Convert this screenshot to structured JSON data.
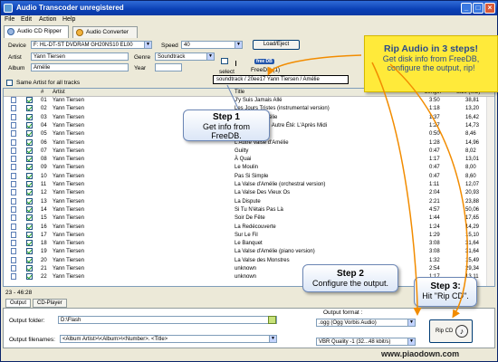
{
  "window": {
    "title": "Audio Transcoder unregistered"
  },
  "menu": [
    "File",
    "Edit",
    "Action",
    "Help"
  ],
  "tabs": [
    {
      "label": "Audio CD Ripper"
    },
    {
      "label": "Audio Converter"
    }
  ],
  "ripper": {
    "device_label": "Device",
    "device_value": "F: HL-DT-ST DVDRAM GH20NS10 EL00",
    "speed_label": "Speed",
    "speed_value": "40",
    "load_eject_label": "Load/Eject",
    "artist_label": "Artist",
    "artist_value": "Yann Tiersen",
    "genre_label": "Genre",
    "genre_value": "Soundtrack",
    "album_label": "Album",
    "album_value": "Amélie",
    "year_label": "Year",
    "year_value": "",
    "same_artist_label": "Same Artist for all tracks",
    "select_label": "select",
    "freedb_label": "FreeDB (1)",
    "freedb_logo": "free DB",
    "freedb_result": "soundtrack / 20ee17 Yann Tiersen / Amélie"
  },
  "grid": {
    "headers": {
      "check": "",
      "num": "#",
      "artist": "Artist",
      "title": "Title",
      "length": "Length",
      "size": "Size (MB)"
    },
    "rows": [
      {
        "num": "01",
        "artist": "Yann Tiersen",
        "title": "J'y Suis Jamais Allé",
        "length": "3:50",
        "size": "38,81"
      },
      {
        "num": "02",
        "artist": "Yann Tiersen",
        "title": "Les Jours Tristes (instrumental version)",
        "length": "1:18",
        "size": "13,20"
      },
      {
        "num": "03",
        "artist": "Yann Tiersen",
        "title": "La Valse d'Amélie",
        "length": "1:37",
        "size": "16,42"
      },
      {
        "num": "04",
        "artist": "Yann Tiersen",
        "title": "Comptine d'Un Autre Été: L'Après Midi",
        "length": "1:27",
        "size": "14,73"
      },
      {
        "num": "05",
        "artist": "Yann Tiersen",
        "title": "La Noyée",
        "length": "0:50",
        "size": "8,46"
      },
      {
        "num": "06",
        "artist": "Yann Tiersen",
        "title": "L'Autre Valse d'Amélie",
        "length": "1:28",
        "size": "14,96"
      },
      {
        "num": "07",
        "artist": "Yann Tiersen",
        "title": "Guilty",
        "length": "0:47",
        "size": "8,02"
      },
      {
        "num": "08",
        "artist": "Yann Tiersen",
        "title": "À Quai",
        "length": "1:17",
        "size": "13,01"
      },
      {
        "num": "09",
        "artist": "Yann Tiersen",
        "title": "Le Moulin",
        "length": "0:47",
        "size": "8,00"
      },
      {
        "num": "10",
        "artist": "Yann Tiersen",
        "title": "Pas Si Simple",
        "length": "0:47",
        "size": "8,60"
      },
      {
        "num": "11",
        "artist": "Yann Tiersen",
        "title": "La Valse d'Amélie (orchestral version)",
        "length": "1:11",
        "size": "12,07"
      },
      {
        "num": "12",
        "artist": "Yann Tiersen",
        "title": "La Valse Des Vieux Os",
        "length": "2:04",
        "size": "20,93"
      },
      {
        "num": "13",
        "artist": "Yann Tiersen",
        "title": "La Dispute",
        "length": "2:21",
        "size": "23,88"
      },
      {
        "num": "14",
        "artist": "Yann Tiersen",
        "title": "Si Tu N'étais Pas Là",
        "length": "4:57",
        "size": "50,06"
      },
      {
        "num": "15",
        "artist": "Yann Tiersen",
        "title": "Soir De Fête",
        "length": "1:44",
        "size": "17,65"
      },
      {
        "num": "16",
        "artist": "Yann Tiersen",
        "title": "La Redécouverte",
        "length": "1:24",
        "size": "14,29"
      },
      {
        "num": "17",
        "artist": "Yann Tiersen",
        "title": "Sur Le Fil",
        "length": "1:29",
        "size": "15,10"
      },
      {
        "num": "18",
        "artist": "Yann Tiersen",
        "title": "Le Banquet",
        "length": "3:08",
        "size": "31,64"
      },
      {
        "num": "19",
        "artist": "Yann Tiersen",
        "title": "La Valse d'Amélie (piano version)",
        "length": "3:08",
        "size": "31,64"
      },
      {
        "num": "20",
        "artist": "Yann Tiersen",
        "title": "La Valse des Monstres",
        "length": "1:32",
        "size": "15,49"
      },
      {
        "num": "21",
        "artist": "Yann Tiersen",
        "title": "unknown",
        "length": "2:54",
        "size": "29,34"
      },
      {
        "num": "22",
        "artist": "Yann Tiersen",
        "title": "unknown",
        "length": "1:17",
        "size": "13,11"
      }
    ]
  },
  "status": {
    "summary": "23 - 46:28"
  },
  "bottom_tabs": [
    {
      "label": "Output"
    },
    {
      "label": "CD-Player"
    }
  ],
  "output": {
    "folder_label": "Output folder:",
    "folder_value": "D:\\Flash",
    "filenames_label": "Output filenames:",
    "filenames_value": "<Album Artist>\\<Album>\\<Number>. <Title>",
    "format_label": "Output format :",
    "format_value": ".ogg  (Ogg Vorbis Audio)",
    "quality_value": "VBR Quality -1 (32...48 kbit/s)",
    "rip_cd_label": "Rip CD"
  },
  "callouts": {
    "step1": {
      "heading": "Step 1",
      "line1": "Get info from",
      "line2": "FreeDB."
    },
    "step2": {
      "heading": "Step 2",
      "line1": "Configure the output."
    },
    "step3": {
      "heading": "Step 3:",
      "line1": "Hit \"Rip CD\"."
    },
    "intro": {
      "heading": "Rip Audio in 3 steps!",
      "line1": "Get disk info from FreeDB,",
      "line2": "configure the output, rip!"
    }
  },
  "watermark": "www.piaodown.com",
  "colors": {
    "title_bar": "#0a3fb4",
    "callout_yellow": "#ffea3a",
    "arrow_orange": "#f28c00",
    "callout_border": "#6b86b5"
  }
}
